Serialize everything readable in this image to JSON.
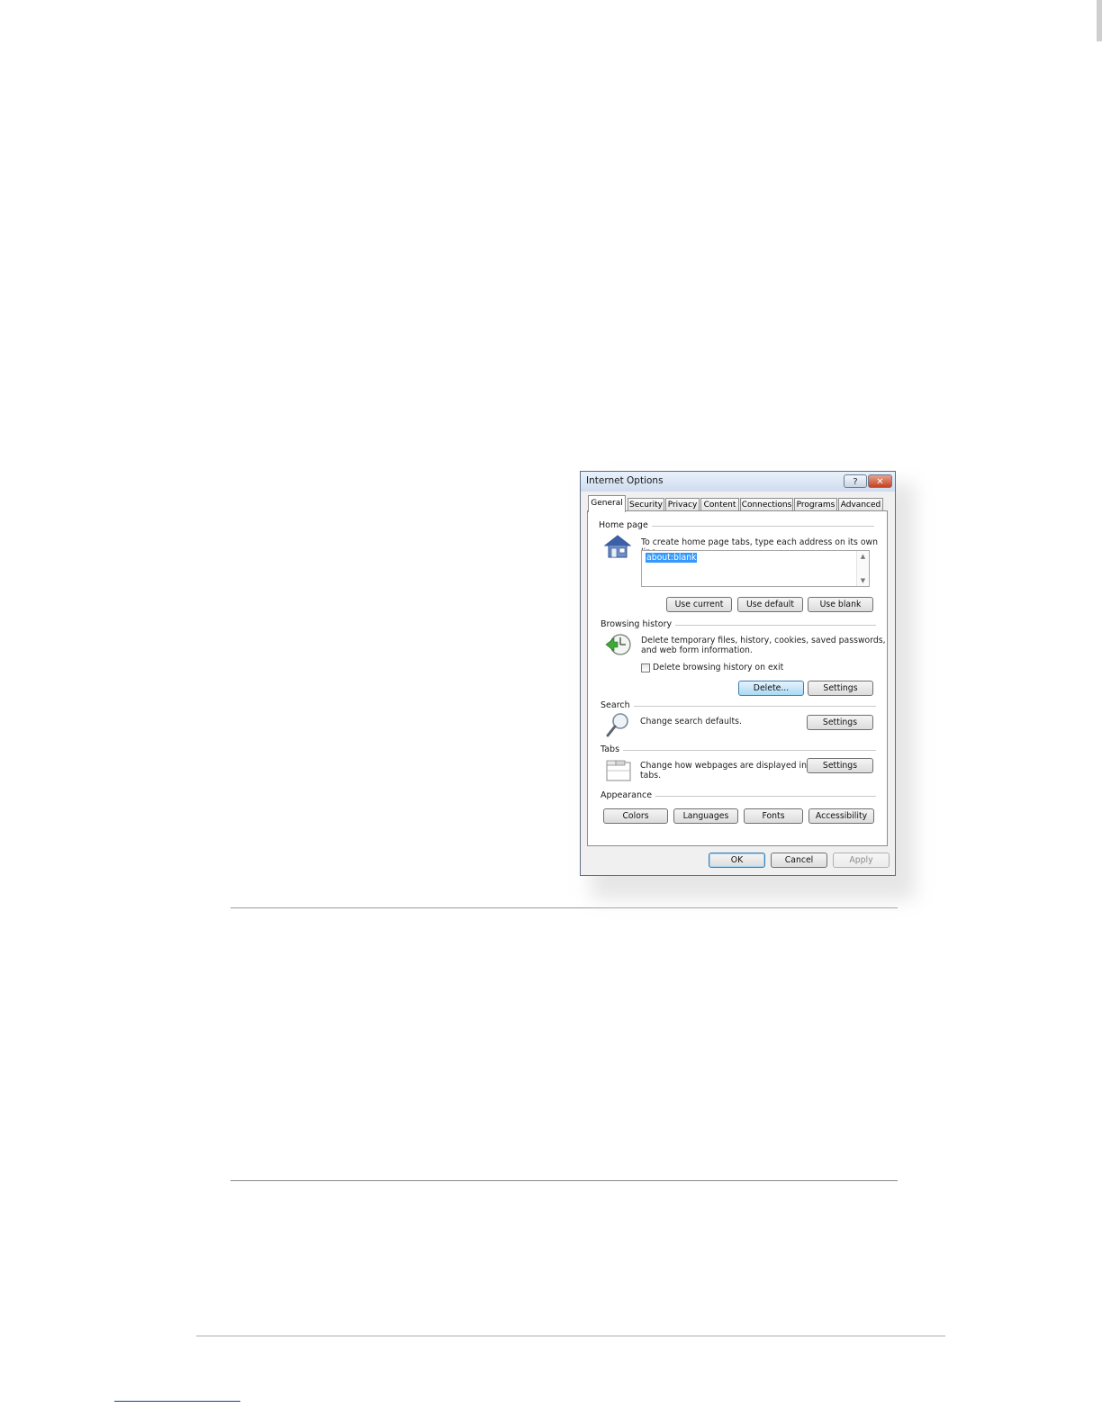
{
  "dialog": {
    "title": "Internet Options",
    "help_button": "?",
    "close_button": "✕",
    "tabs": [
      "General",
      "Security",
      "Privacy",
      "Content",
      "Connections",
      "Programs",
      "Advanced"
    ],
    "active_tab": "General",
    "home_page": {
      "group_label": "Home page",
      "instruction": "To create home page tabs, type each address on its own line.",
      "address_value": "about:blank",
      "use_current": "Use current",
      "use_default": "Use default",
      "use_blank": "Use blank"
    },
    "browsing_history": {
      "group_label": "Browsing history",
      "description_line1": "Delete temporary files, history, cookies, saved passwords,",
      "description_line2": "and web form information.",
      "checkbox_label": "Delete browsing history on exit",
      "checkbox_checked": false,
      "delete_button": "Delete...",
      "settings_button": "Settings"
    },
    "search": {
      "group_label": "Search",
      "description": "Change search defaults.",
      "settings_button": "Settings"
    },
    "tabs_section": {
      "group_label": "Tabs",
      "description_line1": "Change how webpages are displayed in",
      "description_line2": "tabs.",
      "settings_button": "Settings"
    },
    "appearance": {
      "group_label": "Appearance",
      "colors": "Colors",
      "languages": "Languages",
      "fonts": "Fonts",
      "accessibility": "Accessibility"
    },
    "footer": {
      "ok": "OK",
      "cancel": "Cancel",
      "apply": "Apply"
    }
  }
}
